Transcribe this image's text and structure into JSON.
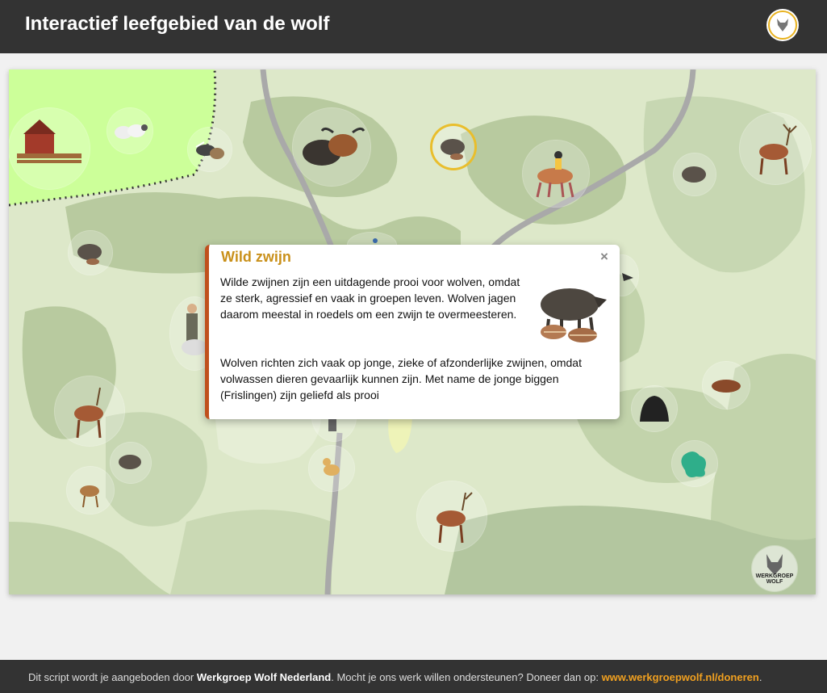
{
  "header": {
    "title": "Interactief leefgebied van de wolf"
  },
  "popup": {
    "title": "Wild zwijn",
    "close_label": "×",
    "paragraph1": "Wilde zwijnen zijn een uitdagende prooi voor wolven, omdat ze sterk, agressief en vaak in groepen leven. Wolven jagen daarom meestal in roedels om een zwijn te overmeesteren.",
    "paragraph2": "Wolven richten zich vaak op jonge, zieke of afzonderlijke zwijnen, omdat volwassen dieren gevaarlijk kunnen zijn. Met name de jonge biggen (Frislingen) zijn geliefd als prooi"
  },
  "map": {
    "watermark": "WERKGROEP WOLF"
  },
  "footer": {
    "prefix": "Dit script wordt je aangeboden door ",
    "org": "Werkgroep Wolf Nederland",
    "middle": ". Mocht je ons werk willen ondersteunen? Doneer dan op: ",
    "link": "www.werkgroepwolf.nl/doneren",
    "suffix": "."
  },
  "colors": {
    "header_bg": "#333333",
    "accent_gold": "#c9901a",
    "accent_rust": "#c0501d",
    "link_orange": "#f0a020",
    "map_light": "#dde8c9",
    "map_dark": "#b3c69f",
    "farm_green": "#ccff99",
    "road": "#a9a9a9"
  }
}
